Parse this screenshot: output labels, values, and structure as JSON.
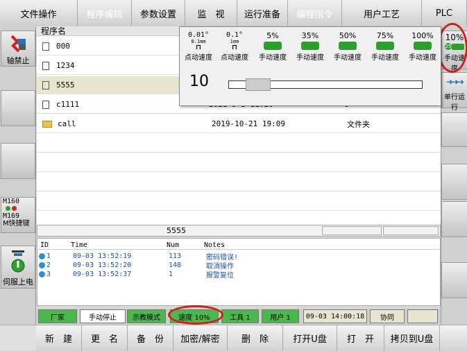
{
  "top_menu": [
    {
      "label": "文件操作",
      "disabled": false
    },
    {
      "label": "程序编辑",
      "disabled": true
    },
    {
      "label": "参数设置",
      "disabled": false
    },
    {
      "label": "监　视",
      "disabled": false
    },
    {
      "label": "运行准备",
      "disabled": false
    },
    {
      "label": "编程指令",
      "disabled": true
    },
    {
      "label": "用户工艺",
      "disabled": false
    },
    {
      "label": "PLC",
      "disabled": false
    }
  ],
  "left": {
    "axis_lock_label": "轴禁止",
    "m160": "M160",
    "m169": "M169",
    "shortcut_label": "M快捷键",
    "servo_label": "伺服上电"
  },
  "right": {
    "speed_value": "10%",
    "speed_caption": "手动速度",
    "single_run_label": "单行运行"
  },
  "file_list": {
    "header": "程序名",
    "rows": [
      {
        "name": "000",
        "date": "",
        "type": "",
        "is_folder": false
      },
      {
        "name": "1234",
        "date": "",
        "type": "",
        "is_folder": false
      },
      {
        "name": "5555",
        "date": "",
        "type": "",
        "is_folder": false,
        "selected": true
      },
      {
        "name": "c1111",
        "date": "2021-9-3 11:20",
        "type": "0",
        "is_folder": false
      },
      {
        "name": "call",
        "date": "2019-10-21 19:09",
        "type": "文件夹",
        "is_folder": true
      }
    ]
  },
  "speed_popup": {
    "options": [
      {
        "value": "0.01°",
        "sub": "0.1mm",
        "caption": "点动速度"
      },
      {
        "value": "0.1°",
        "sub": "1mm",
        "caption": "点动速度"
      },
      {
        "value": "5%",
        "caption": "手动速度",
        "hand": "25"
      },
      {
        "value": "35%",
        "caption": "手动速度",
        "hand": "25"
      },
      {
        "value": "50%",
        "caption": "手动速度",
        "hand": "25"
      },
      {
        "value": "75%",
        "caption": "手动速度",
        "hand": "25"
      },
      {
        "value": "100%",
        "caption": "手动速度",
        "hand": "25"
      }
    ],
    "slider_value": "10",
    "slider_level": 0.1
  },
  "filename_bar": {
    "name": "5555"
  },
  "log": {
    "headers": {
      "id": "ID",
      "time": "Time",
      "num": "Num",
      "notes": "Notes"
    },
    "rows": [
      {
        "id": "1",
        "time": "09-03 13:52:19",
        "num": "113",
        "notes": "密码错误!"
      },
      {
        "id": "2",
        "time": "09-03 13:52:20",
        "num": "148",
        "notes": "取消操作"
      },
      {
        "id": "3",
        "time": "09-03 13:52:37",
        "num": "1",
        "notes": "报警复位"
      }
    ]
  },
  "status": {
    "vendor": "厂家",
    "stop": "手动停止",
    "mode": "示教模式",
    "speed": "速度 10%",
    "tool": "工具 1",
    "user": "用户 1",
    "datetime": "09-03 14:00:18",
    "sync": "协同"
  },
  "bottom_menu": [
    "新　建",
    "更　名",
    "备　份",
    "加密/解密",
    "删　除",
    "打开U盘",
    "打　开",
    "拷贝到U盘"
  ],
  "colors": {
    "green": "#2e9e2e",
    "status_green": "#4bb84b",
    "red": "#d0201a",
    "highlight": "#e8e6cf"
  }
}
